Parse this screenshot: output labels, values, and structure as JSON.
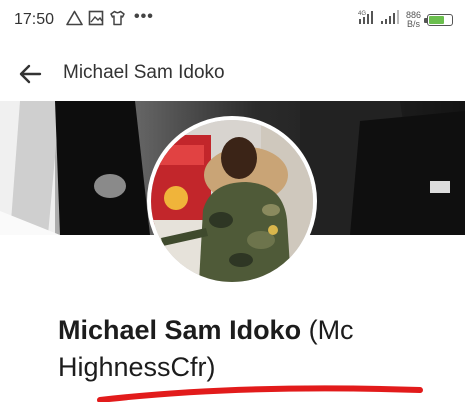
{
  "status_bar": {
    "time": "17:50",
    "icons": [
      "warning-icon",
      "image-icon",
      "tshirt-icon",
      "more-dots-icon"
    ],
    "dots": "•••",
    "speed_value": "886",
    "speed_unit": "B/s",
    "battery_level": 0.72,
    "battery_color": "#6bbf4e"
  },
  "app_bar": {
    "title": "Michael Sam Idoko",
    "back_icon": "arrow-left-icon"
  },
  "profile": {
    "name_bold": "Michael Sam Idoko",
    "name_rest": " (Mc HighnessCfr)",
    "annotation_color": "#e21b1b"
  }
}
